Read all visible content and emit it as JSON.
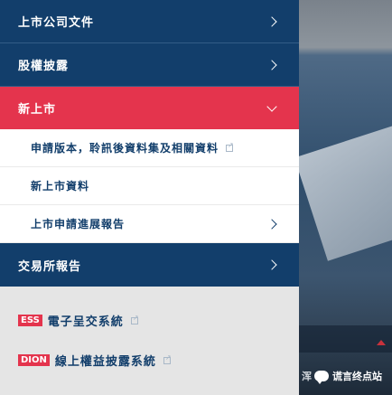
{
  "menu": {
    "items": [
      {
        "label": "上市公司文件"
      },
      {
        "label": "股權披露"
      },
      {
        "label": "新上市"
      },
      {
        "label": "交易所報告"
      }
    ],
    "submenu": [
      {
        "label": "申請版本，聆訊後資料集及相關資料"
      },
      {
        "label": "新上市資料"
      },
      {
        "label": "上市申請進展報告"
      }
    ],
    "external": [
      {
        "badge": "ESS",
        "label": "電子呈交系統"
      },
      {
        "badge": "DION",
        "label": "線上權益披露系統"
      }
    ]
  },
  "watermark": {
    "prefix": "浑",
    "text": "谎言终点站"
  },
  "colors": {
    "navy": "#123e6b",
    "active": "#e4344d",
    "panel": "#e5e5e5"
  }
}
